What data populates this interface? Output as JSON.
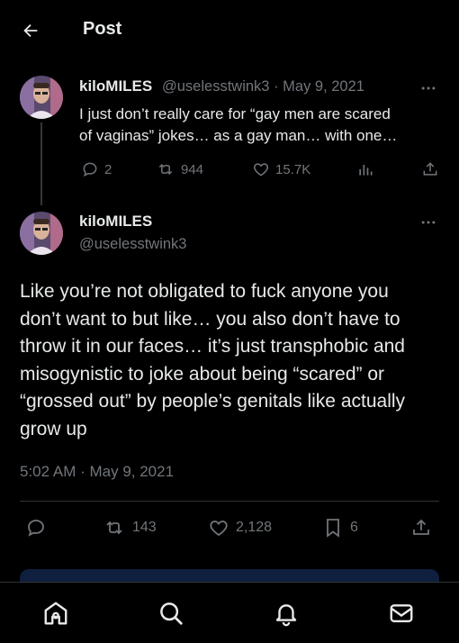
{
  "header": {
    "title": "Post"
  },
  "parent_tweet": {
    "name": "kiloMILES",
    "handle": "@uselesstwink3",
    "separator": "·",
    "date": "May 9, 2021",
    "text_line1": "I just don’t really care for “gay men are scared",
    "text_line2": "of vaginas” jokes… as a gay man… with one…",
    "replies": "2",
    "reposts": "944",
    "likes": "15.7K"
  },
  "main_tweet": {
    "name": "kiloMILES",
    "handle": "@uselesstwink3",
    "text_lines": [
      "Like you’re not obligated to fuck anyone you",
      "don’t want to but like… you also don’t have to",
      "throw it in our faces… it’s just transphobic and",
      "misogynistic to joke about being “scared” or",
      "“grossed out” by people’s genitals like actually",
      "grow up"
    ],
    "timestamp": "5:02 AM · May 9, 2021",
    "reposts": "143",
    "likes": "2,128",
    "bookmarks": "6"
  },
  "icons": {
    "back": "arrow-left-icon",
    "more": "more-horizontal-icon",
    "reply": "reply-icon",
    "repost": "repost-icon",
    "like": "heart-icon",
    "views": "views-icon",
    "share": "share-icon",
    "bookmark": "bookmark-icon",
    "home": "home-icon",
    "search": "search-icon",
    "notifications": "bell-icon",
    "messages": "mail-icon"
  },
  "colors": {
    "background": "#000000",
    "text": "#e7e9ea",
    "muted": "#71767b",
    "divider": "#2f3336"
  }
}
